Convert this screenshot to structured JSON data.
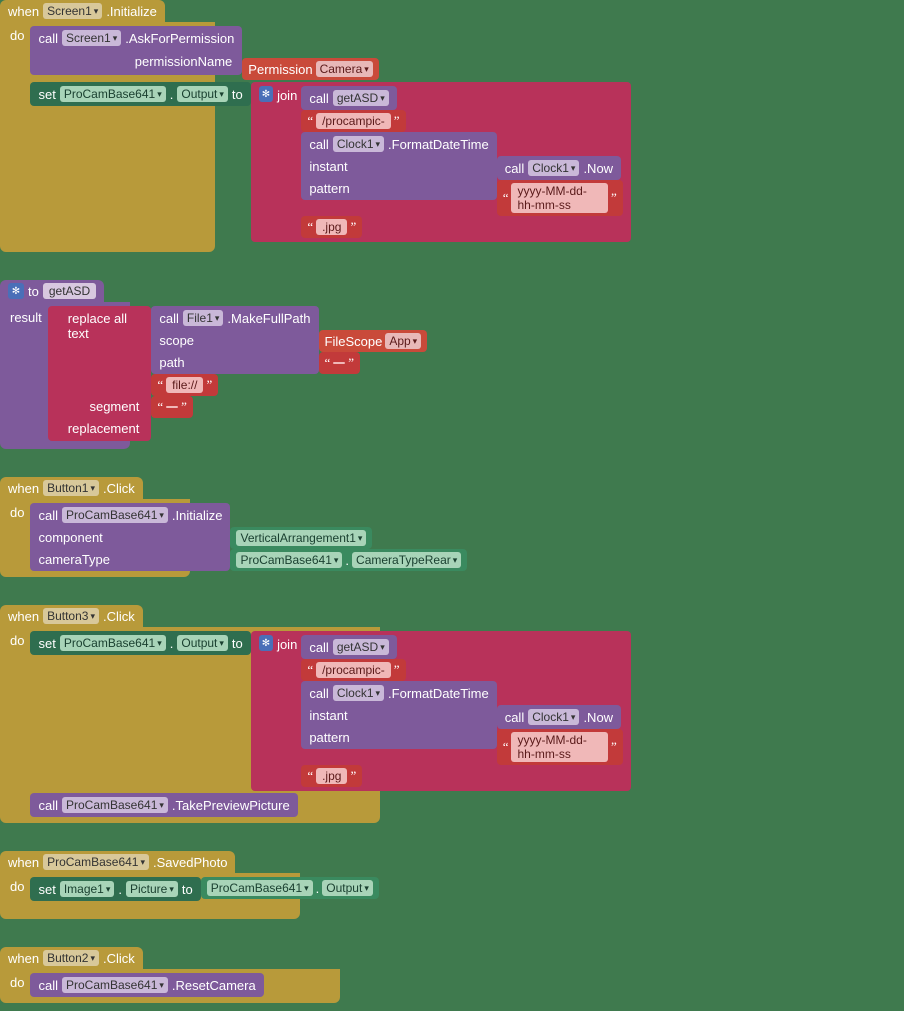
{
  "kw": {
    "when": "when",
    "do": "do",
    "call": "call",
    "set": "set",
    "to": "to",
    "join": "join",
    "result": "result",
    "replace_all_text": "replace all text",
    "segment": "segment",
    "replacement": "replacement",
    "scope": "scope",
    "path": "path",
    "instant": "instant",
    "pattern": "pattern",
    "component": "component",
    "cameraType": "cameraType",
    "permissionName": "permissionName"
  },
  "comp": {
    "Screen1": "Screen1",
    "ProCamBase641": "ProCamBase641",
    "Clock1": "Clock1",
    "File1": "File1",
    "Button1": "Button1",
    "Button2": "Button2",
    "Button3": "Button3",
    "Image1": "Image1",
    "VerticalArrangement1": "VerticalArrangement1"
  },
  "meth": {
    "Initialize": ".Initialize",
    "AskForPermission": ".AskForPermission",
    "FormatDateTime": ".FormatDateTime",
    "Now": ".Now",
    "MakeFullPath": ".MakeFullPath",
    "Click": ".Click",
    "TakePreviewPicture": ".TakePreviewPicture",
    "SavedPhoto": ".SavedPhoto",
    "ResetCamera": ".ResetCamera"
  },
  "prop": {
    "Output": "Output",
    "Picture": "Picture",
    "CameraTypeRear": "CameraTypeRear"
  },
  "proc": {
    "getASD": "getASD"
  },
  "enum": {
    "Permission": "Permission",
    "Camera": "Camera",
    "FileScope": "FileScope",
    "App": "App"
  },
  "str": {
    "procampic": "/procampic-",
    "jpg": ".jpg",
    "datefmt": "yyyy-MM-dd-hh-mm-ss",
    "fileuri": "file://",
    "empty": " ",
    "dot": "."
  }
}
